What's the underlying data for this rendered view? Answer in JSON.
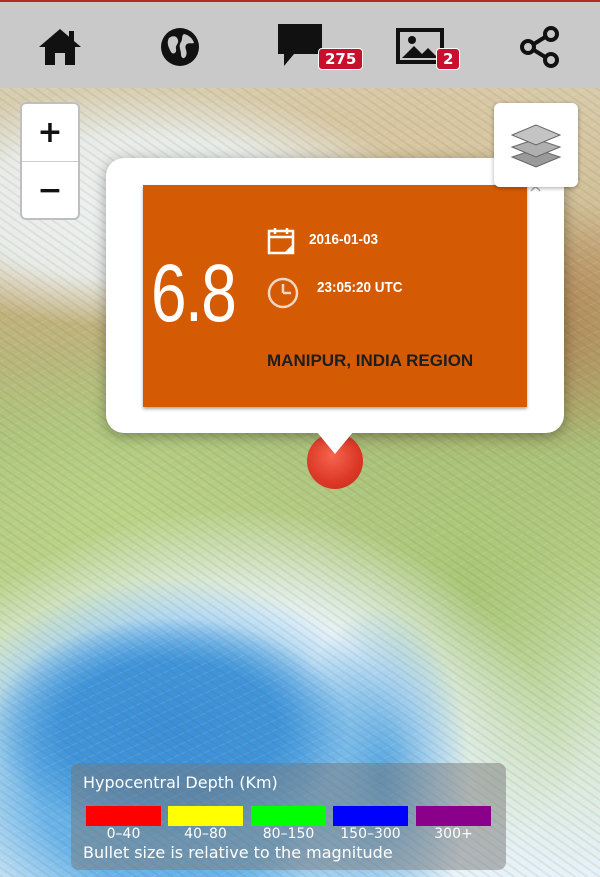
{
  "nav": {
    "items": [
      {
        "name": "home",
        "icon": "home-icon"
      },
      {
        "name": "globe",
        "icon": "globe-icon"
      },
      {
        "name": "comments",
        "icon": "comment-icon",
        "badge": "275"
      },
      {
        "name": "photos",
        "icon": "image-icon",
        "badge": "2"
      },
      {
        "name": "share",
        "icon": "share-icon"
      }
    ]
  },
  "map": {
    "zoom_in_label": "+",
    "zoom_out_label": "−",
    "layers_icon": "layers-icon"
  },
  "popup": {
    "magnitude": "6.8",
    "date": "2016-01-03",
    "time": "23:05:20 UTC",
    "region": "MANIPUR, INDIA REGION",
    "close_label": "×",
    "card_color": "#d45a04"
  },
  "legend": {
    "title": "Hypocentral Depth (Km)",
    "ranges": [
      {
        "label": "0–40",
        "color": "#ff0000"
      },
      {
        "label": "40–80",
        "color": "#ffff00"
      },
      {
        "label": "80–150",
        "color": "#00ff00"
      },
      {
        "label": "150–300",
        "color": "#0000ff"
      },
      {
        "label": "300+",
        "color": "#8b008b"
      }
    ],
    "note": "Bullet size is relative to the magnitude"
  }
}
